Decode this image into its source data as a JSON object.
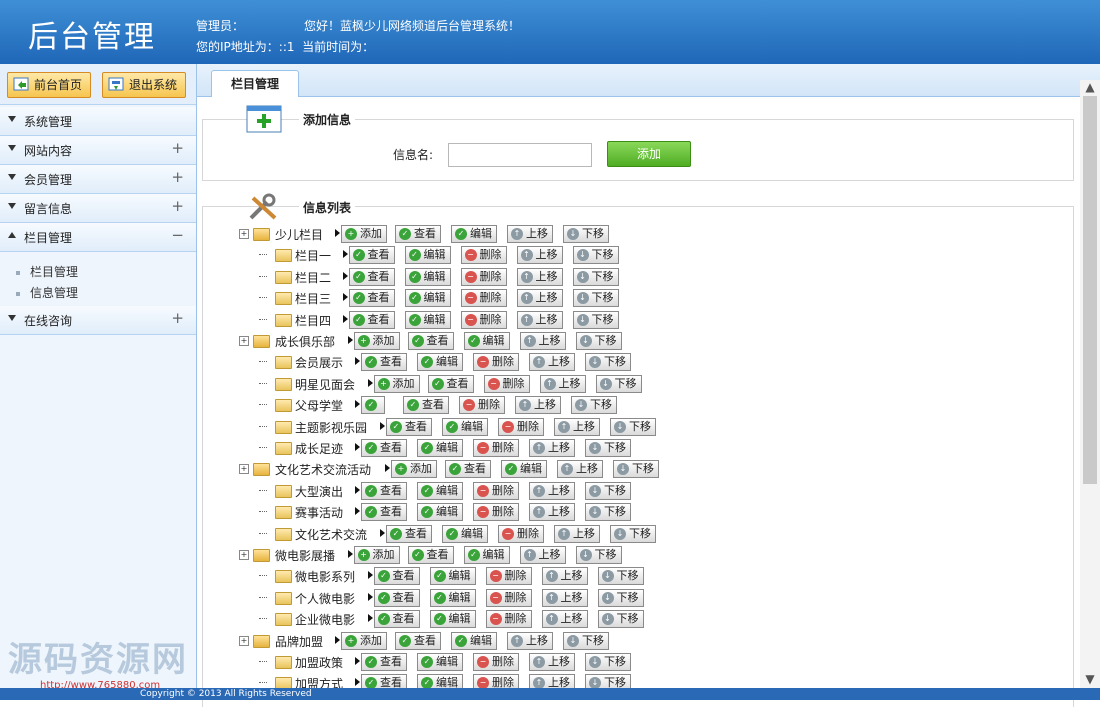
{
  "header": {
    "logo": "后台管理",
    "line1": {
      "admin_label": "管理员：",
      "greeting": "您好！蓝枫少儿网络频道后台管理系统！"
    },
    "line2": {
      "ip_text": "您的IP地址为：::1",
      "time_label": "当前时间为："
    }
  },
  "sidebar": {
    "home_btn": "前台首页",
    "logout_btn": "退出系统",
    "menus": [
      {
        "label": "系统管理",
        "toggle": ""
      },
      {
        "label": "网站内容",
        "toggle": "+"
      },
      {
        "label": "会员管理",
        "toggle": "+"
      },
      {
        "label": "留言信息",
        "toggle": "+"
      },
      {
        "label": "栏目管理",
        "toggle": "−"
      },
      {
        "label": "在线咨询",
        "toggle": "+"
      }
    ],
    "submenu": [
      "栏目管理",
      "信息管理"
    ]
  },
  "watermark": "源码资源网",
  "watermark_url": "http://www.765880.com",
  "main": {
    "tab": "栏目管理",
    "add_section": {
      "title": "添加信息",
      "field_label": "信息名:",
      "input_value": "",
      "add_button": "添加"
    },
    "list_section": {
      "title": "信息列表"
    },
    "buttons": {
      "add": "添加",
      "view": "查看",
      "edit": "编辑",
      "delete": "删除",
      "up": "上移",
      "down": "下移"
    },
    "tree": [
      {
        "name": "少儿栏目",
        "level": 0,
        "actions": [
          "add",
          "view",
          "edit",
          "up",
          "down"
        ]
      },
      {
        "name": "栏目一",
        "level": 1,
        "actions": [
          "view",
          "edit",
          "delete",
          "up",
          "down"
        ]
      },
      {
        "name": "栏目二",
        "level": 1,
        "actions": [
          "view",
          "edit",
          "delete",
          "up",
          "down"
        ]
      },
      {
        "name": "栏目三",
        "level": 1,
        "actions": [
          "view",
          "edit",
          "delete",
          "up",
          "down"
        ]
      },
      {
        "name": "栏目四",
        "level": 1,
        "actions": [
          "view",
          "edit",
          "delete",
          "up",
          "down"
        ]
      },
      {
        "name": "成长俱乐部",
        "level": 0,
        "actions": [
          "add",
          "view",
          "edit",
          "up",
          "down"
        ]
      },
      {
        "name": "会员展示",
        "level": 1,
        "actions": [
          "view",
          "edit",
          "delete",
          "up",
          "down"
        ]
      },
      {
        "name": "明星见面会",
        "level": 1,
        "actions": [
          "add",
          "view",
          "delete",
          "up",
          "down"
        ]
      },
      {
        "name": "父母学堂",
        "level": 1,
        "actions": [
          "blank",
          "view",
          "delete",
          "up",
          "down"
        ]
      },
      {
        "name": "主题影视乐园",
        "level": 1,
        "actions": [
          "view",
          "edit",
          "delete",
          "up",
          "down"
        ]
      },
      {
        "name": "成长足迹",
        "level": 1,
        "actions": [
          "view",
          "edit",
          "delete",
          "up",
          "down"
        ]
      },
      {
        "name": "文化艺术交流活动",
        "level": 0,
        "actions": [
          "add",
          "view",
          "edit",
          "up",
          "down"
        ]
      },
      {
        "name": "大型演出",
        "level": 1,
        "actions": [
          "view",
          "edit",
          "delete",
          "up",
          "down"
        ]
      },
      {
        "name": "赛事活动",
        "level": 1,
        "actions": [
          "view",
          "edit",
          "delete",
          "up",
          "down"
        ]
      },
      {
        "name": "文化艺术交流",
        "level": 1,
        "actions": [
          "view",
          "edit",
          "delete",
          "up",
          "down"
        ]
      },
      {
        "name": "微电影展播",
        "level": 0,
        "actions": [
          "add",
          "view",
          "edit",
          "up",
          "down"
        ]
      },
      {
        "name": "微电影系列",
        "level": 1,
        "actions": [
          "view",
          "edit",
          "delete",
          "up",
          "down"
        ]
      },
      {
        "name": "个人微电影",
        "level": 1,
        "actions": [
          "view",
          "edit",
          "delete",
          "up",
          "down"
        ]
      },
      {
        "name": "企业微电影",
        "level": 1,
        "actions": [
          "view",
          "edit",
          "delete",
          "up",
          "down"
        ]
      },
      {
        "name": "品牌加盟",
        "level": 0,
        "actions": [
          "add",
          "view",
          "edit",
          "up",
          "down"
        ]
      },
      {
        "name": "加盟政策",
        "level": 1,
        "actions": [
          "view",
          "edit",
          "delete",
          "up",
          "down"
        ]
      },
      {
        "name": "加盟方式",
        "level": 1,
        "actions": [
          "view",
          "edit",
          "delete",
          "up",
          "down"
        ]
      }
    ]
  },
  "footer": "Copyright © 2013 All Rights Reserved",
  "colors": {
    "header": "#2a72c4",
    "accent_green": "#4fad23",
    "menu_border": "#9cc3ea"
  }
}
